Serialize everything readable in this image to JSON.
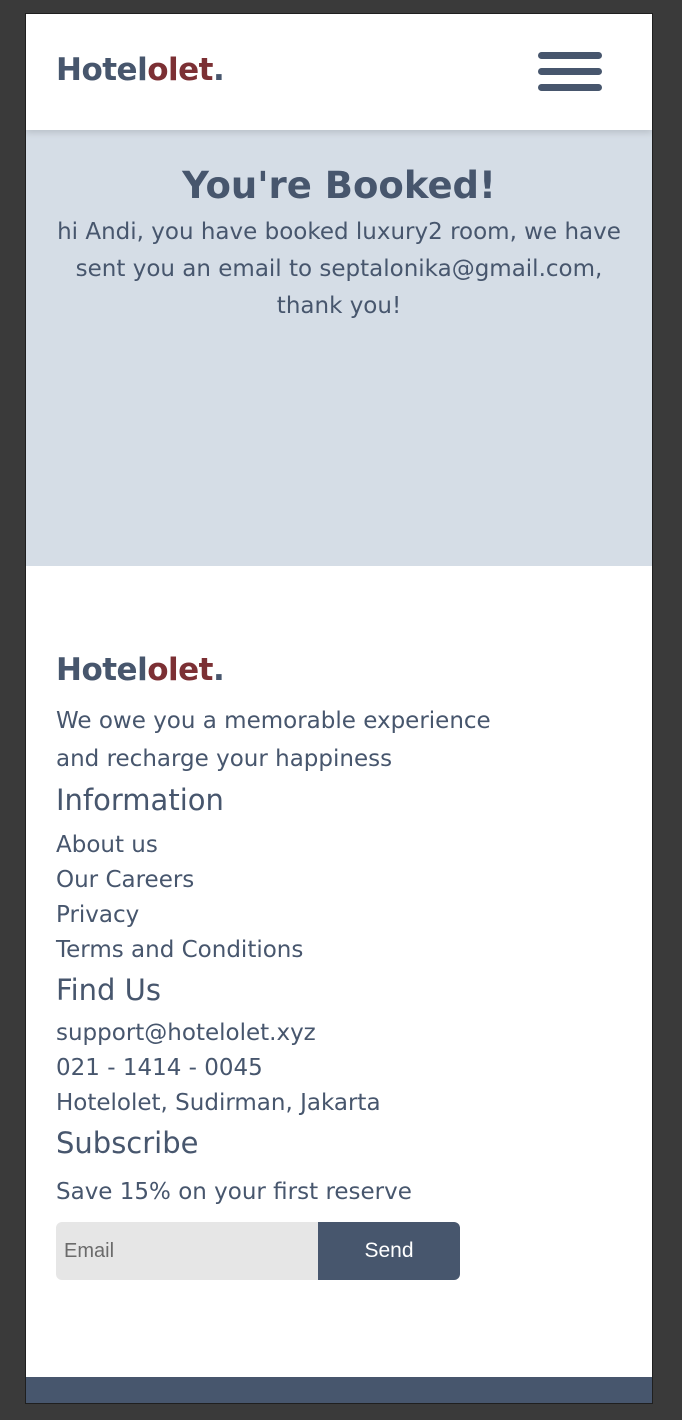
{
  "brand": {
    "name_main": "Hotel",
    "name_accent": "olet",
    "name_dot": "."
  },
  "header": {
    "menu_icon": "hamburger-menu-icon"
  },
  "hero": {
    "title": "You're Booked!",
    "message": "hi Andi, you have booked luxury2 room, we have sent you an email to septalonika@gmail.com, thank you!"
  },
  "footer": {
    "tagline_line1": "We owe you a memorable experience",
    "tagline_line2": "and recharge your happiness",
    "information": {
      "heading": "Information",
      "links": [
        "About us",
        "Our Careers",
        "Privacy",
        "Terms and Conditions"
      ]
    },
    "find_us": {
      "heading": "Find Us",
      "email": "support@hotelolet.xyz",
      "phone": "021 - 1414 - 0045",
      "address": "Hotelolet, Sudirman, Jakarta"
    },
    "subscribe": {
      "heading": "Subscribe",
      "text": "Save 15% on your first reserve",
      "email_placeholder": "Email",
      "email_value": "",
      "send_label": "Send"
    }
  },
  "colors": {
    "primary": "#47566d",
    "accent": "#7c3034",
    "hero_bg": "#d5dde6",
    "input_bg": "#e6e6e6"
  }
}
